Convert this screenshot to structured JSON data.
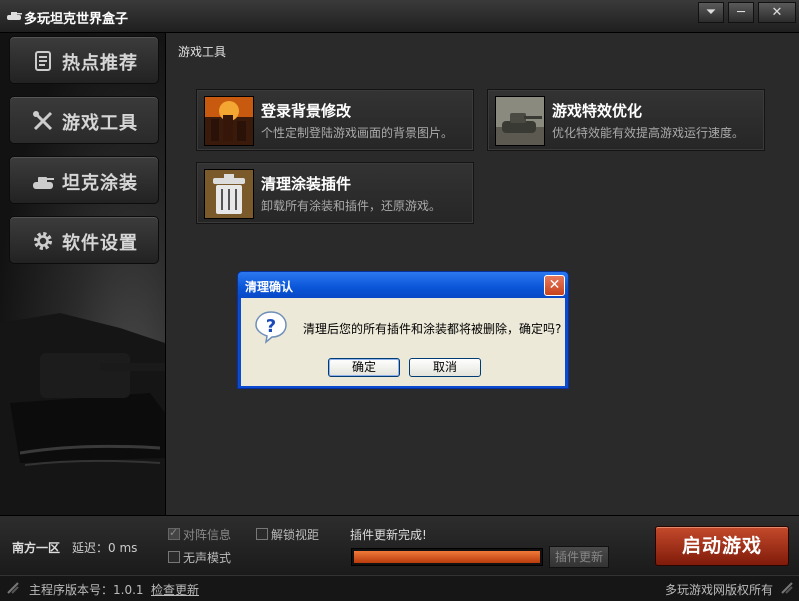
{
  "window": {
    "title": "多玩坦克世界盒子",
    "app_icon": "tank-icon",
    "controls": [
      "dropdown-icon",
      "minimize-icon",
      "close-icon"
    ],
    "control_glyphs": {
      "dropdown": "⏷",
      "minimize": "─",
      "close": "✕"
    }
  },
  "sidebar": {
    "items": [
      {
        "label": "热点推荐",
        "icon": "news-icon"
      },
      {
        "label": "游戏工具",
        "icon": "tools-icon"
      },
      {
        "label": "坦克涂装",
        "icon": "tank-icon"
      },
      {
        "label": "软件设置",
        "icon": "gear-icon"
      }
    ]
  },
  "main": {
    "title": "游戏工具",
    "tools": [
      {
        "title": "登录背景修改",
        "desc": "个性定制登陆游戏画面的背景图片。",
        "thumb": "burning-city-image"
      },
      {
        "title": "游戏特效优化",
        "desc": "优化特效能有效提高游戏运行速度。",
        "thumb": "tank-photo-image"
      },
      {
        "title": "清理涂装插件",
        "desc": "卸载所有涂装和插件，还原游戏。",
        "thumb": "trash-can-image"
      }
    ]
  },
  "dialog": {
    "title": "清理确认",
    "close_glyph": "✕",
    "icon": "question-icon",
    "message": "清理后您的所有插件和涂装都将被删除，确定吗?",
    "ok_label": "确定",
    "cancel_label": "取消"
  },
  "bottom": {
    "server": "南方一区",
    "latency": "延迟：0 ms",
    "options": {
      "team_info": {
        "label": "对阵信息",
        "checked": true
      },
      "unlock_view": {
        "label": "解锁视距",
        "checked": false
      },
      "silent_mode": {
        "label": "无声模式",
        "checked": false
      }
    },
    "plugin_status": "插件更新完成!",
    "progress_fraction": 1.0,
    "update_button": "插件更新",
    "launch_button": "启动游戏"
  },
  "statusbar": {
    "version": "主程序版本号：1.0.1",
    "check_update": "检查更新",
    "copyright": "多玩游戏网版权所有"
  },
  "colors": {
    "launch_button": "#a83217",
    "progress": "#e0652a",
    "dialog_title": "#0a55d8",
    "dialog_body": "#ece9d8"
  }
}
